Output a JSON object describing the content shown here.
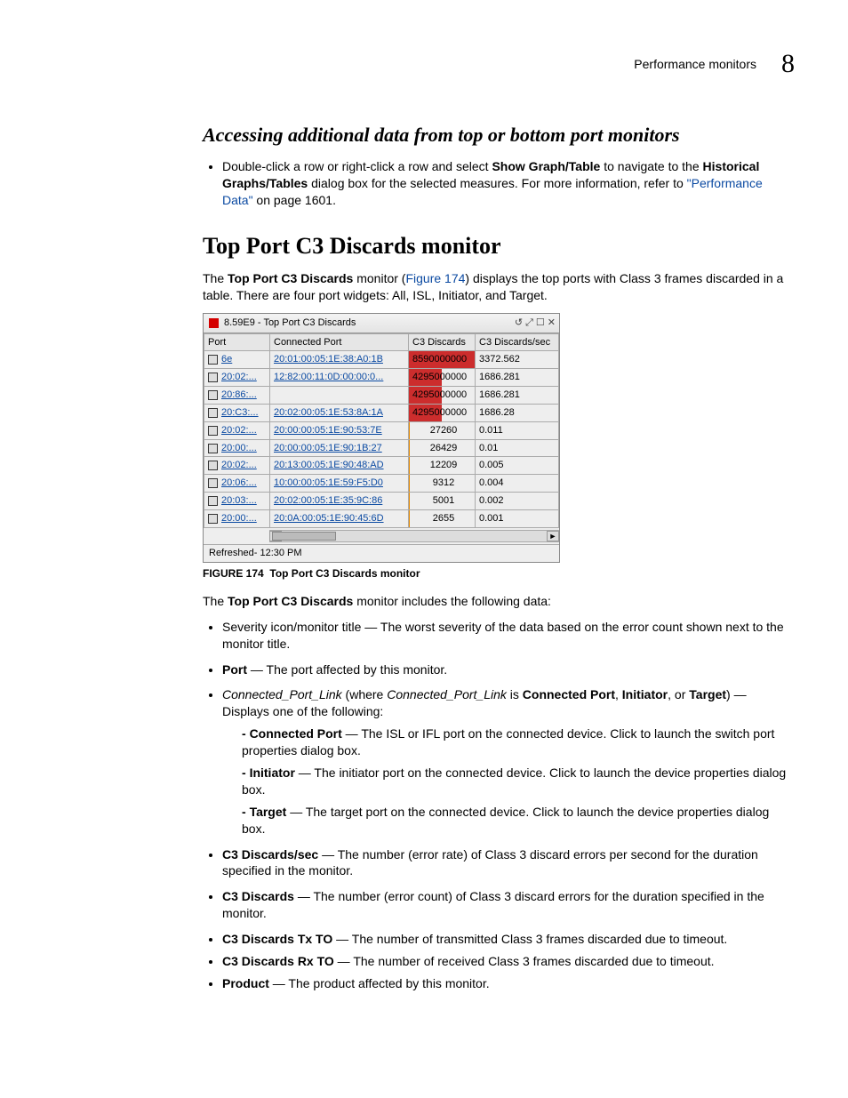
{
  "header": {
    "running_head": "Performance monitors",
    "chapter_number": "8"
  },
  "section1": {
    "heading": "Accessing additional data from top or bottom port monitors",
    "bullet_pre": "Double-click a row or right-click a row and select ",
    "bullet_bold1": "Show Graph/Table",
    "bullet_mid": " to navigate to the ",
    "bullet_bold2": "Historical Graphs/Tables",
    "bullet_post": " dialog box for the selected measures. For more information, refer to ",
    "link_text": "\"Performance Data\"",
    "link_tail": " on page 1601."
  },
  "section2": {
    "heading": "Top Port C3 Discards monitor",
    "intro_pre": "The ",
    "intro_bold": "Top Port C3 Discards",
    "intro_mid": " monitor (",
    "intro_figref": "Figure 174",
    "intro_post": ") displays the top ports with Class 3 frames discarded in a table. There are four port widgets: All, ISL, Initiator, and Target.",
    "after_fig_pre": "The ",
    "after_fig_bold": "Top Port C3 Discards",
    "after_fig_post": " monitor includes the following data:"
  },
  "widget": {
    "title": "8.59E9 - Top Port C3 Discards",
    "icons": [
      "↺",
      "⤢",
      "☐",
      "✕"
    ],
    "columns": [
      "Port",
      "Connected Port",
      "C3 Discards",
      "C3 Discards/sec"
    ],
    "rows": [
      {
        "port": "6e",
        "conn": "20:01:00:05:1E:38:A0:1B",
        "disc": "8590000000",
        "bar": 100,
        "style": "red",
        "rate": "3372.562"
      },
      {
        "port": "20:02:...",
        "conn": "12:82:00:11:0D:00:00:0...",
        "disc": "4295000000",
        "bar": 50,
        "style": "red",
        "rate": "1686.281"
      },
      {
        "port": "20:86:...",
        "conn": "",
        "disc": "4295000000",
        "bar": 50,
        "style": "red",
        "rate": "1686.281"
      },
      {
        "port": "20:C3:...",
        "conn": "20:02:00:05:1E:53:8A:1A",
        "disc": "4295000000",
        "bar": 50,
        "style": "red",
        "rate": "1686.28"
      },
      {
        "port": "20:02:...",
        "conn": "20:00:00:05:1E:90:53:7E",
        "disc": "27260",
        "bar": 2,
        "style": "orange",
        "rate": "0.011"
      },
      {
        "port": "20:00:...",
        "conn": "20:00:00:05:1E:90:1B:27",
        "disc": "26429",
        "bar": 2,
        "style": "orange",
        "rate": "0.01"
      },
      {
        "port": "20:02:...",
        "conn": "20:13:00:05:1E:90:48:AD",
        "disc": "12209",
        "bar": 1.5,
        "style": "orange",
        "rate": "0.005"
      },
      {
        "port": "20:06:...",
        "conn": "10:00:00:05:1E:59:F5:D0",
        "disc": "9312",
        "bar": 1.5,
        "style": "orange",
        "rate": "0.004"
      },
      {
        "port": "20:03:...",
        "conn": "20:02:00:05:1E:35:9C:86",
        "disc": "5001",
        "bar": 1.2,
        "style": "orange",
        "rate": "0.002"
      },
      {
        "port": "20:00:...",
        "conn": "20:0A:00:05:1E:90:45:6D",
        "disc": "2655",
        "bar": 1,
        "style": "orange",
        "rate": "0.001"
      }
    ],
    "refreshed": "Refreshed- 12:30 PM"
  },
  "figure": {
    "label": "FIGURE 174",
    "caption": "Top Port C3 Discards monitor"
  },
  "datalist": {
    "a_text": "Severity icon/monitor title — The worst severity of the data based on the error count shown next to the monitor title.",
    "b_bold": "Port",
    "b_text": " — The port affected by this monitor.",
    "c_em1": "Connected_Port_Link",
    "c_mid1": " (where ",
    "c_em2": "Connected_Port_Link",
    "c_mid2": " is ",
    "c_b1": "Connected Port",
    "c_sep1": ", ",
    "c_b2": "Initiator",
    "c_sep2": ", or ",
    "c_b3": "Target",
    "c_tail": ") — Displays one of the following:",
    "c_sub1_b": "Connected Port",
    "c_sub1_t": " — The ISL or IFL port on the connected device. Click to launch the switch port properties dialog box.",
    "c_sub2_b": "Initiator",
    "c_sub2_t": " — The initiator port on the connected device. Click to launch the device properties dialog box.",
    "c_sub3_b": "Target",
    "c_sub3_t": " — The target port on the connected device. Click to launch the device properties dialog box.",
    "d_b": "C3 Discards/sec",
    "d_t": " — The number (error rate) of Class 3 discard errors per second for the duration specified in the monitor.",
    "e_b": "C3 Discards",
    "e_t": " — The number (error count) of Class 3 discard errors for the duration specified in the monitor.",
    "f_b": "C3 Discards Tx TO",
    "f_t": " — The number of transmitted Class 3 frames discarded due to timeout.",
    "g_b": "C3 Discards Rx TO",
    "g_t": " — The number of received Class 3 frames discarded due to timeout.",
    "h_b": "Product",
    "h_t": " — The product affected by this monitor."
  }
}
